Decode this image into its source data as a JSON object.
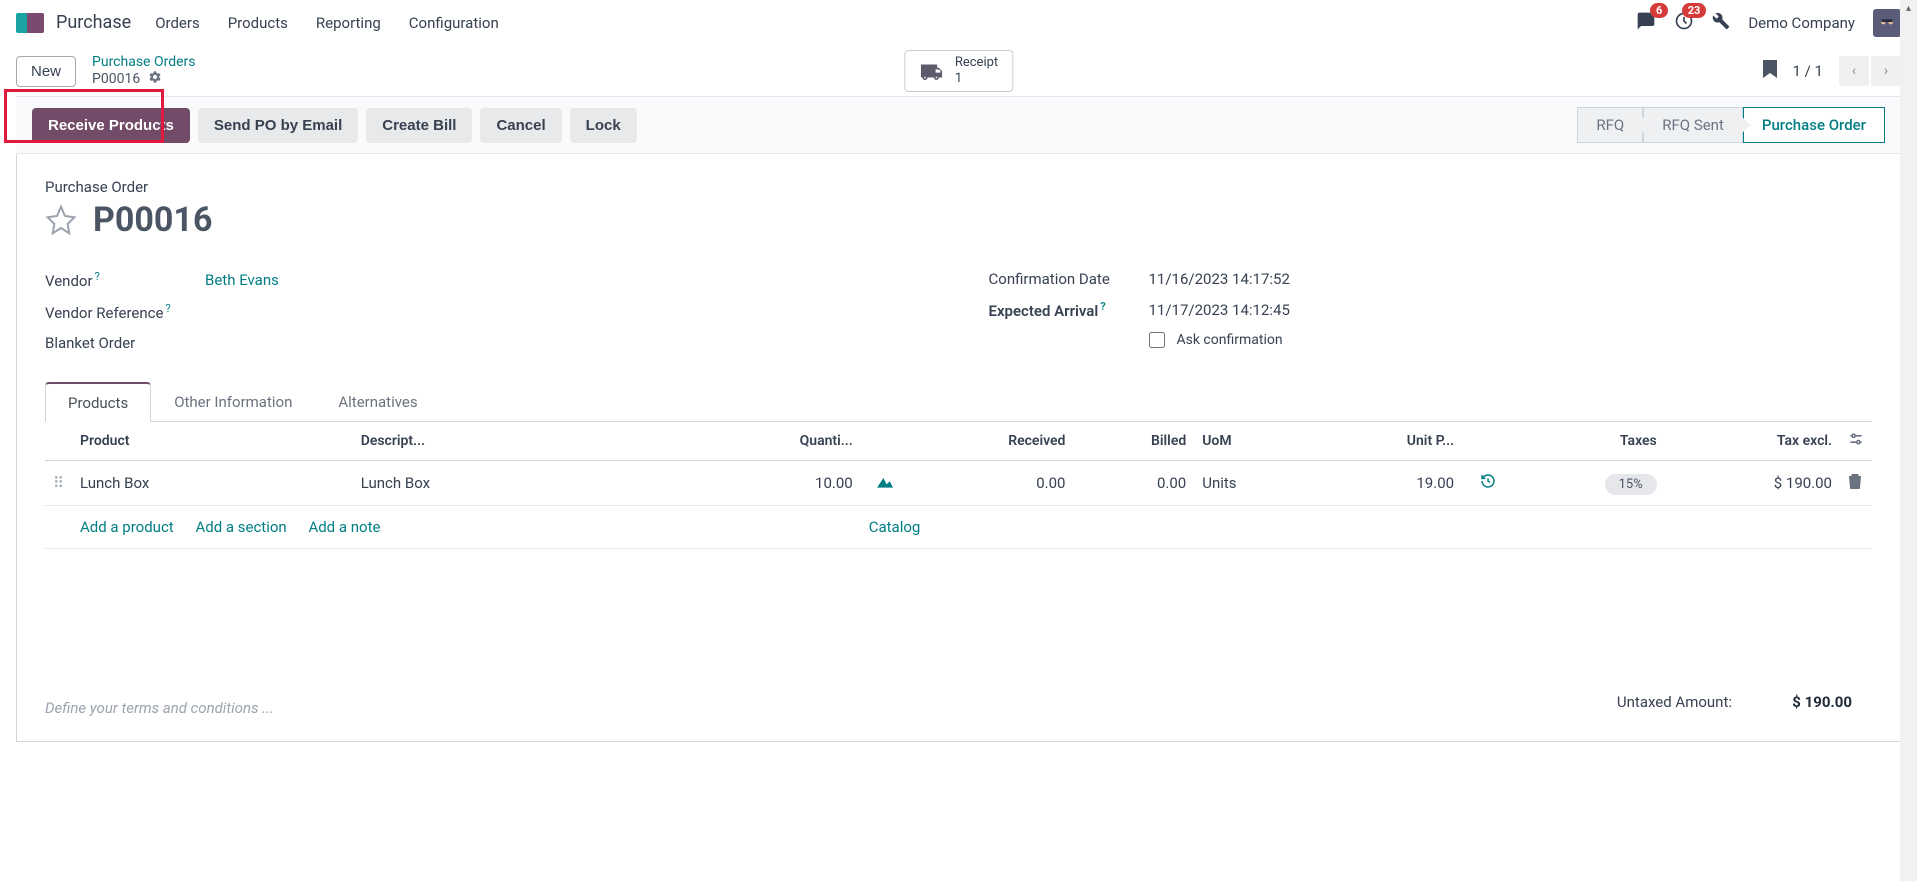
{
  "header": {
    "app_title": "Purchase",
    "nav": [
      "Orders",
      "Products",
      "Reporting",
      "Configuration"
    ],
    "chat_badge": "6",
    "activity_badge": "23",
    "company": "Demo Company"
  },
  "control": {
    "new_label": "New",
    "breadcrumb_parent": "Purchase Orders",
    "breadcrumb_current": "P00016",
    "stat_button_label": "Receipt",
    "stat_button_count": "1",
    "pager": "1 / 1"
  },
  "actions": {
    "receive": "Receive Products",
    "send": "Send PO by Email",
    "bill": "Create Bill",
    "cancel": "Cancel",
    "lock": "Lock"
  },
  "status_steps": {
    "rfq": "RFQ",
    "rfq_sent": "RFQ Sent",
    "po": "Purchase Order"
  },
  "doc": {
    "type_label": "Purchase Order",
    "name": "P00016",
    "fields": {
      "vendor_label": "Vendor",
      "vendor_value": "Beth Evans",
      "vendor_ref_label": "Vendor Reference",
      "blanket_label": "Blanket Order",
      "confirm_date_label": "Confirmation Date",
      "confirm_date_value": "11/16/2023 14:17:52",
      "expected_label": "Expected Arrival",
      "expected_value": "11/17/2023 14:12:45",
      "ask_confirm_label": "Ask confirmation"
    }
  },
  "tabs": {
    "products": "Products",
    "other": "Other Information",
    "alternatives": "Alternatives"
  },
  "table": {
    "headers": {
      "product": "Product",
      "description": "Descript...",
      "quantity": "Quanti...",
      "received": "Received",
      "billed": "Billed",
      "uom": "UoM",
      "unit_price": "Unit P...",
      "taxes": "Taxes",
      "tax_excl": "Tax excl."
    },
    "row": {
      "product": "Lunch Box",
      "description": "Lunch Box",
      "quantity": "10.00",
      "received": "0.00",
      "billed": "0.00",
      "uom": "Units",
      "unit_price": "19.00",
      "taxes": "15%",
      "tax_excl": "$ 190.00"
    },
    "add_links": {
      "product": "Add a product",
      "section": "Add a section",
      "note": "Add a note",
      "catalog": "Catalog"
    }
  },
  "terms_placeholder": "Define your terms and conditions ...",
  "totals": {
    "untaxed_label": "Untaxed Amount:",
    "untaxed_value": "$ 190.00"
  }
}
